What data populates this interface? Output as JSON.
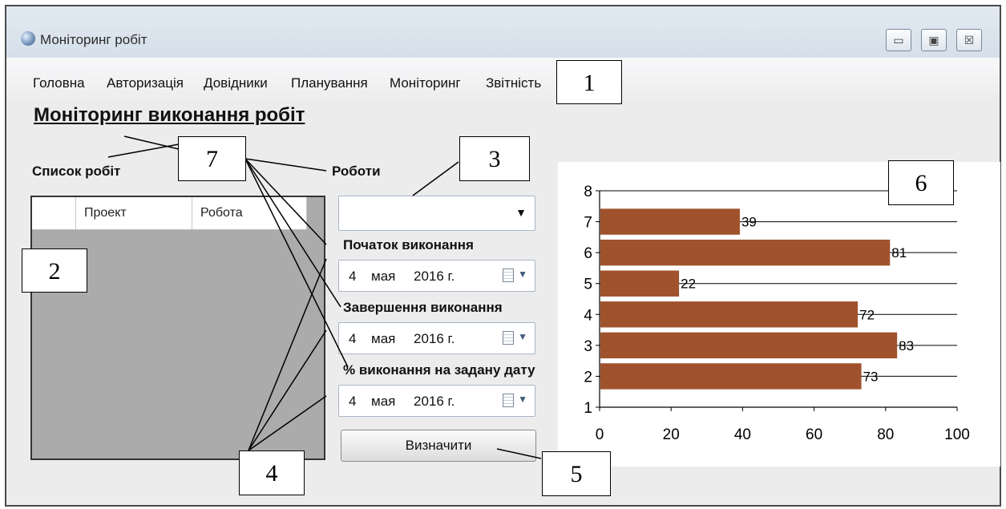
{
  "window": {
    "title": "Моніторинг робіт",
    "buttons": {
      "minimize": "▭",
      "maximize": "▣",
      "close": "☒"
    }
  },
  "menu": [
    "Головна",
    "Авторизація",
    "Довідники",
    "Планування",
    "Моніторинг",
    "Звітність"
  ],
  "page": {
    "heading": "Моніторинг виконання робіт"
  },
  "jobs_list": {
    "label": "Список робіт",
    "columns": [
      "Проект",
      "Робота"
    ]
  },
  "form": {
    "jobs_label": "Роботи",
    "jobs_value": "",
    "start_label": "Початок виконання",
    "end_label": "Завершення виконання",
    "percent_label": "% виконання на задану дату",
    "dates": [
      {
        "day": "4",
        "month": "мая",
        "year": "2016 г."
      },
      {
        "day": "4",
        "month": "мая",
        "year": "2016 г."
      },
      {
        "day": "4",
        "month": "мая",
        "year": "2016 г."
      }
    ],
    "submit_label": "Визначити"
  },
  "callouts": [
    "1",
    "2",
    "3",
    "4",
    "5",
    "6",
    "7"
  ],
  "colors": {
    "bar": "#a0522d",
    "title_bar": "#dce4ed",
    "grid_bg": "#ababab"
  },
  "icons": {
    "app": "globe-icon",
    "date_picker": "calendar-icon",
    "dropdown": "chevron-down-icon"
  },
  "chart_data": {
    "type": "bar",
    "orientation": "horizontal",
    "categories": [
      "2",
      "3",
      "4",
      "5",
      "6",
      "7"
    ],
    "values": [
      73,
      83,
      72,
      22,
      81,
      39
    ],
    "data_labels": [
      "73",
      "83",
      "72",
      "22",
      "81",
      "39"
    ],
    "xlim": [
      0,
      100
    ],
    "x_ticks": [
      "0",
      "20",
      "40",
      "60",
      "80",
      "100"
    ],
    "ylim": [
      1,
      8
    ],
    "y_ticks": [
      "1",
      "2",
      "3",
      "4",
      "5",
      "6",
      "7",
      "8"
    ],
    "grid": true
  }
}
